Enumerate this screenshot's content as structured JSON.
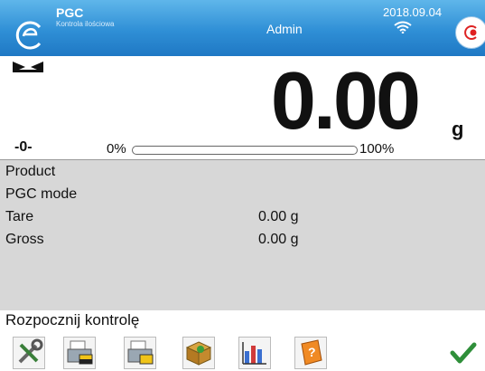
{
  "header": {
    "app_title": "PGC",
    "app_subtitle": "Kontrola ilościowa",
    "user": "Admin",
    "date": "2018.09.04"
  },
  "display": {
    "weight": "0.00",
    "unit": "g",
    "zero_indicator": "-0-",
    "range_start": "0%",
    "range_end": "100%",
    "range_fill": 0
  },
  "info": {
    "rows": [
      {
        "label": "Product",
        "value": ""
      },
      {
        "label": "PGC mode",
        "value": ""
      },
      {
        "label": "Tare",
        "value": "0.00 g"
      },
      {
        "label": "Gross",
        "value": "0.00 g"
      }
    ]
  },
  "prompt": "Rozpocznij kontrolę",
  "toolbar": {
    "buttons": [
      "settings-tools-icon",
      "label-printer-icon",
      "printer-icon",
      "database-box-icon",
      "statistics-chart-icon",
      "help-book-icon",
      "confirm-check-icon"
    ]
  },
  "colors": {
    "header": "#2f8fd6",
    "panel": "#d7d7d7",
    "check": "#2f8f3a"
  }
}
